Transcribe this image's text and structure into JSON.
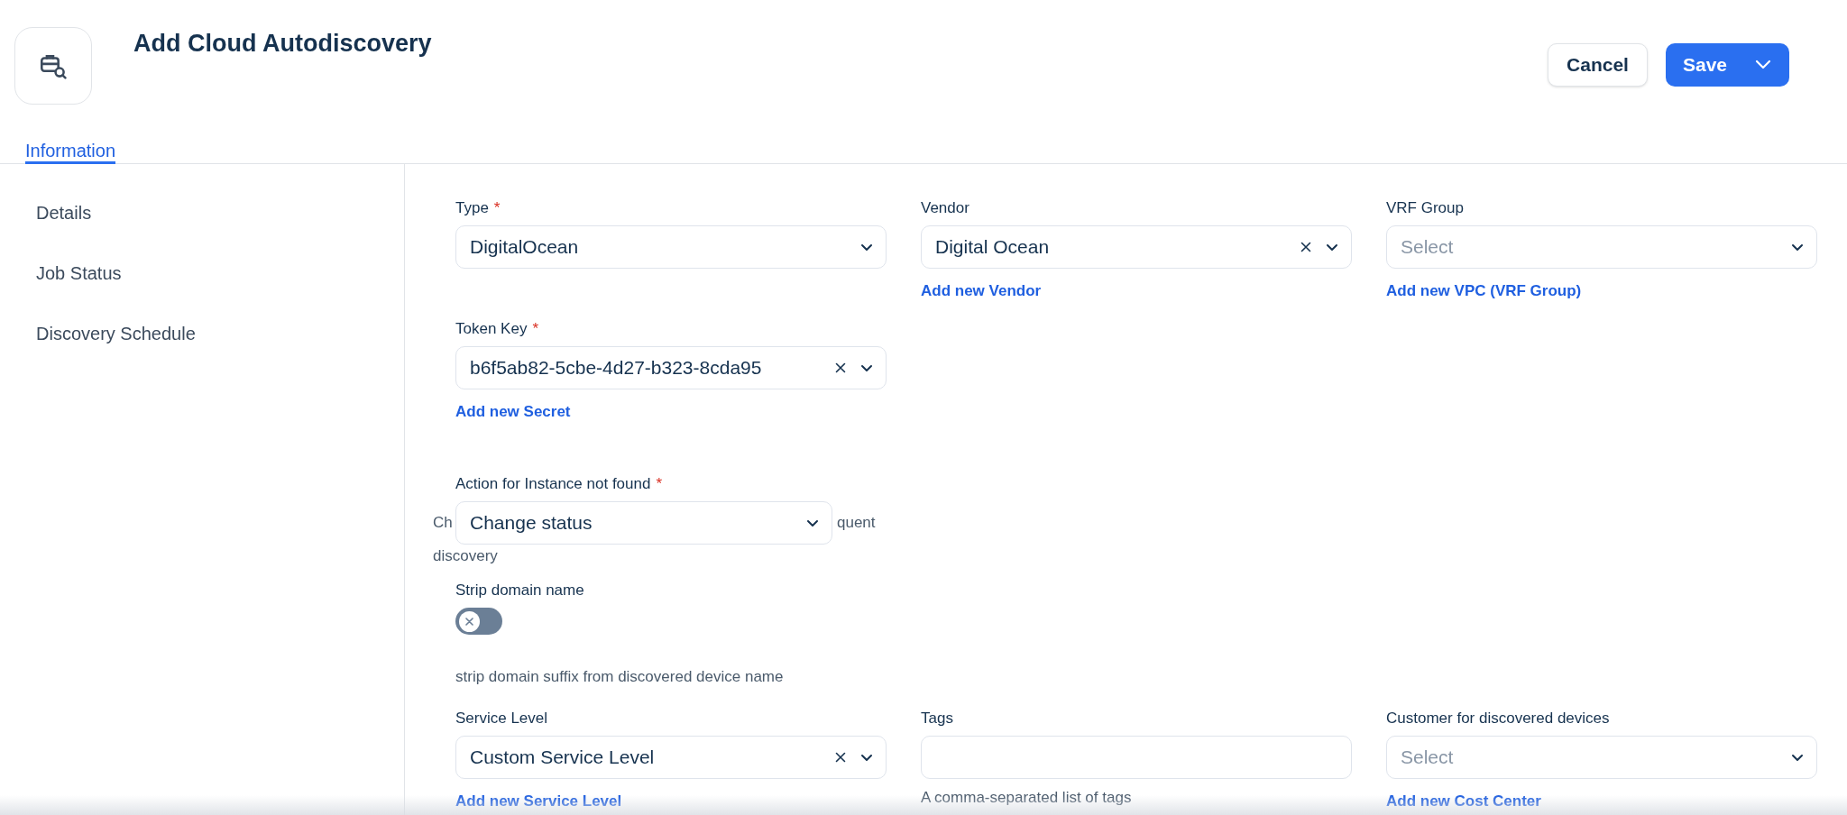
{
  "header": {
    "title": "Add Cloud Autodiscovery",
    "buttons": [
      {
        "label": "Cancel",
        "kind": "secondary"
      },
      {
        "label": "Save",
        "kind": "primary"
      }
    ]
  },
  "tabs": [
    {
      "label": "Information",
      "selected": true
    }
  ],
  "sidebar": {
    "items": [
      "Details",
      "Job Status",
      "Discovery Schedule"
    ]
  },
  "form": {
    "rows": [
      {
        "fields": [
          {
            "kind": "select",
            "label": "Type",
            "required_mark": "*",
            "value": "DigitalOcean",
            "clearable": false
          },
          {
            "kind": "select",
            "label": "Vendor",
            "value": "Digital Ocean",
            "clearable": true,
            "link": "Add new Vendor"
          },
          {
            "kind": "select",
            "label": "VRF Group",
            "placeholder": "Select",
            "clearable": false,
            "link": "Add new VPC (VRF Group)"
          }
        ]
      },
      {
        "fields": [
          {
            "kind": "select",
            "label": "Token Key",
            "required_mark": "*",
            "value": "b6f5ab82-5cbe-4d27-b323-8cda95",
            "clearable": true,
            "link": "Add new Secret"
          }
        ]
      },
      {
        "fields": [
          {
            "kind": "overlay_select",
            "label": "Action for Instance not found",
            "required_mark": "*",
            "value": "Change status",
            "help_parts": [
              "Ch",
              "quent",
              "discovery"
            ]
          }
        ]
      },
      {
        "fields": [
          {
            "kind": "toggle",
            "label": "Strip domain name",
            "on": false,
            "help": "strip domain suffix from discovered device name"
          }
        ]
      },
      {
        "fields": [
          {
            "kind": "select",
            "label": "Service Level",
            "value": "Custom Service Level",
            "clearable": true,
            "link": "Add new Service Level"
          },
          {
            "kind": "text",
            "label": "Tags",
            "help": "A comma-separated list of tags"
          },
          {
            "kind": "select",
            "label": "Customer for discovered devices",
            "placeholder": "Select",
            "clearable": false,
            "link": "Add new Cost Center"
          }
        ]
      }
    ]
  }
}
